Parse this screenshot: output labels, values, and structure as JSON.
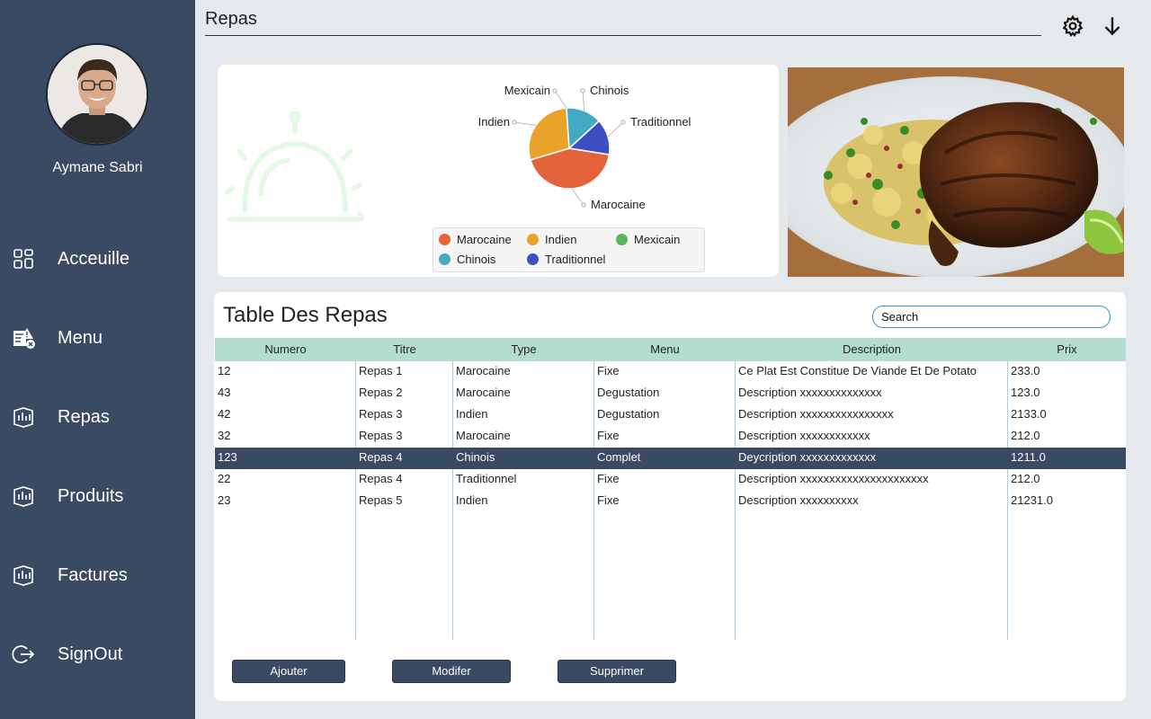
{
  "user": {
    "name": "Aymane Sabri"
  },
  "nav": {
    "items": [
      {
        "label": "Acceuille",
        "icon": "grid-icon"
      },
      {
        "label": "Menu",
        "icon": "menu-warning-icon"
      },
      {
        "label": "Repas",
        "icon": "meal-icon"
      },
      {
        "label": "Produits",
        "icon": "products-icon"
      },
      {
        "label": "Factures",
        "icon": "invoice-icon"
      },
      {
        "label": "SignOut",
        "icon": "signout-icon"
      }
    ]
  },
  "header": {
    "title": "Repas",
    "settings_icon": "gear-icon",
    "download_icon": "arrow-down-icon"
  },
  "chart_data": {
    "type": "pie",
    "categories": [
      "Marocaine",
      "Indien",
      "Mexicain",
      "Chinois",
      "Traditionnel"
    ],
    "values": [
      3,
      2,
      0,
      1,
      1
    ],
    "colors": [
      "#e3633a",
      "#eaa22a",
      "#5ab55e",
      "#46a9c4",
      "#3d4fbe"
    ],
    "legend_position": "bottom"
  },
  "table": {
    "title": "Table Des Repas",
    "search_placeholder": "Search",
    "columns": [
      "Numero",
      "Titre",
      "Type",
      "Menu",
      "Description",
      "Prix"
    ],
    "rows": [
      [
        "12",
        "Repas 1",
        "Marocaine",
        "Fixe",
        "Ce Plat Est Constitue De Viande Et De Potato",
        "233.0"
      ],
      [
        "43",
        "Repas 2",
        "Marocaine",
        "Degustation",
        "Description xxxxxxxxxxxxxx",
        "123.0"
      ],
      [
        "42",
        "Repas 3",
        "Indien",
        "Degustation",
        "Description xxxxxxxxxxxxxxxx",
        "2133.0"
      ],
      [
        "32",
        "Repas 3",
        "Marocaine",
        "Fixe",
        "Description xxxxxxxxxxxx",
        "212.0"
      ],
      [
        "123",
        "Repas 4",
        "Chinois",
        "Complet",
        "Deycription xxxxxxxxxxxxx",
        "1211.0"
      ],
      [
        "22",
        "Repas 4",
        "Traditionnel",
        "Fixe",
        "Description xxxxxxxxxxxxxxxxxxxxxx",
        "212.0"
      ],
      [
        "23",
        "Repas 5",
        "Indien",
        "Fixe",
        "Description xxxxxxxxxx",
        "21231.0"
      ]
    ],
    "selected_row": 4
  },
  "buttons": {
    "add": "Ajouter",
    "edit": "Modifer",
    "delete": "Supprimer"
  },
  "colors": {
    "sidebar": "#3a4a63",
    "header_row": "#b3ddd1",
    "accent": "#3a90c8"
  }
}
